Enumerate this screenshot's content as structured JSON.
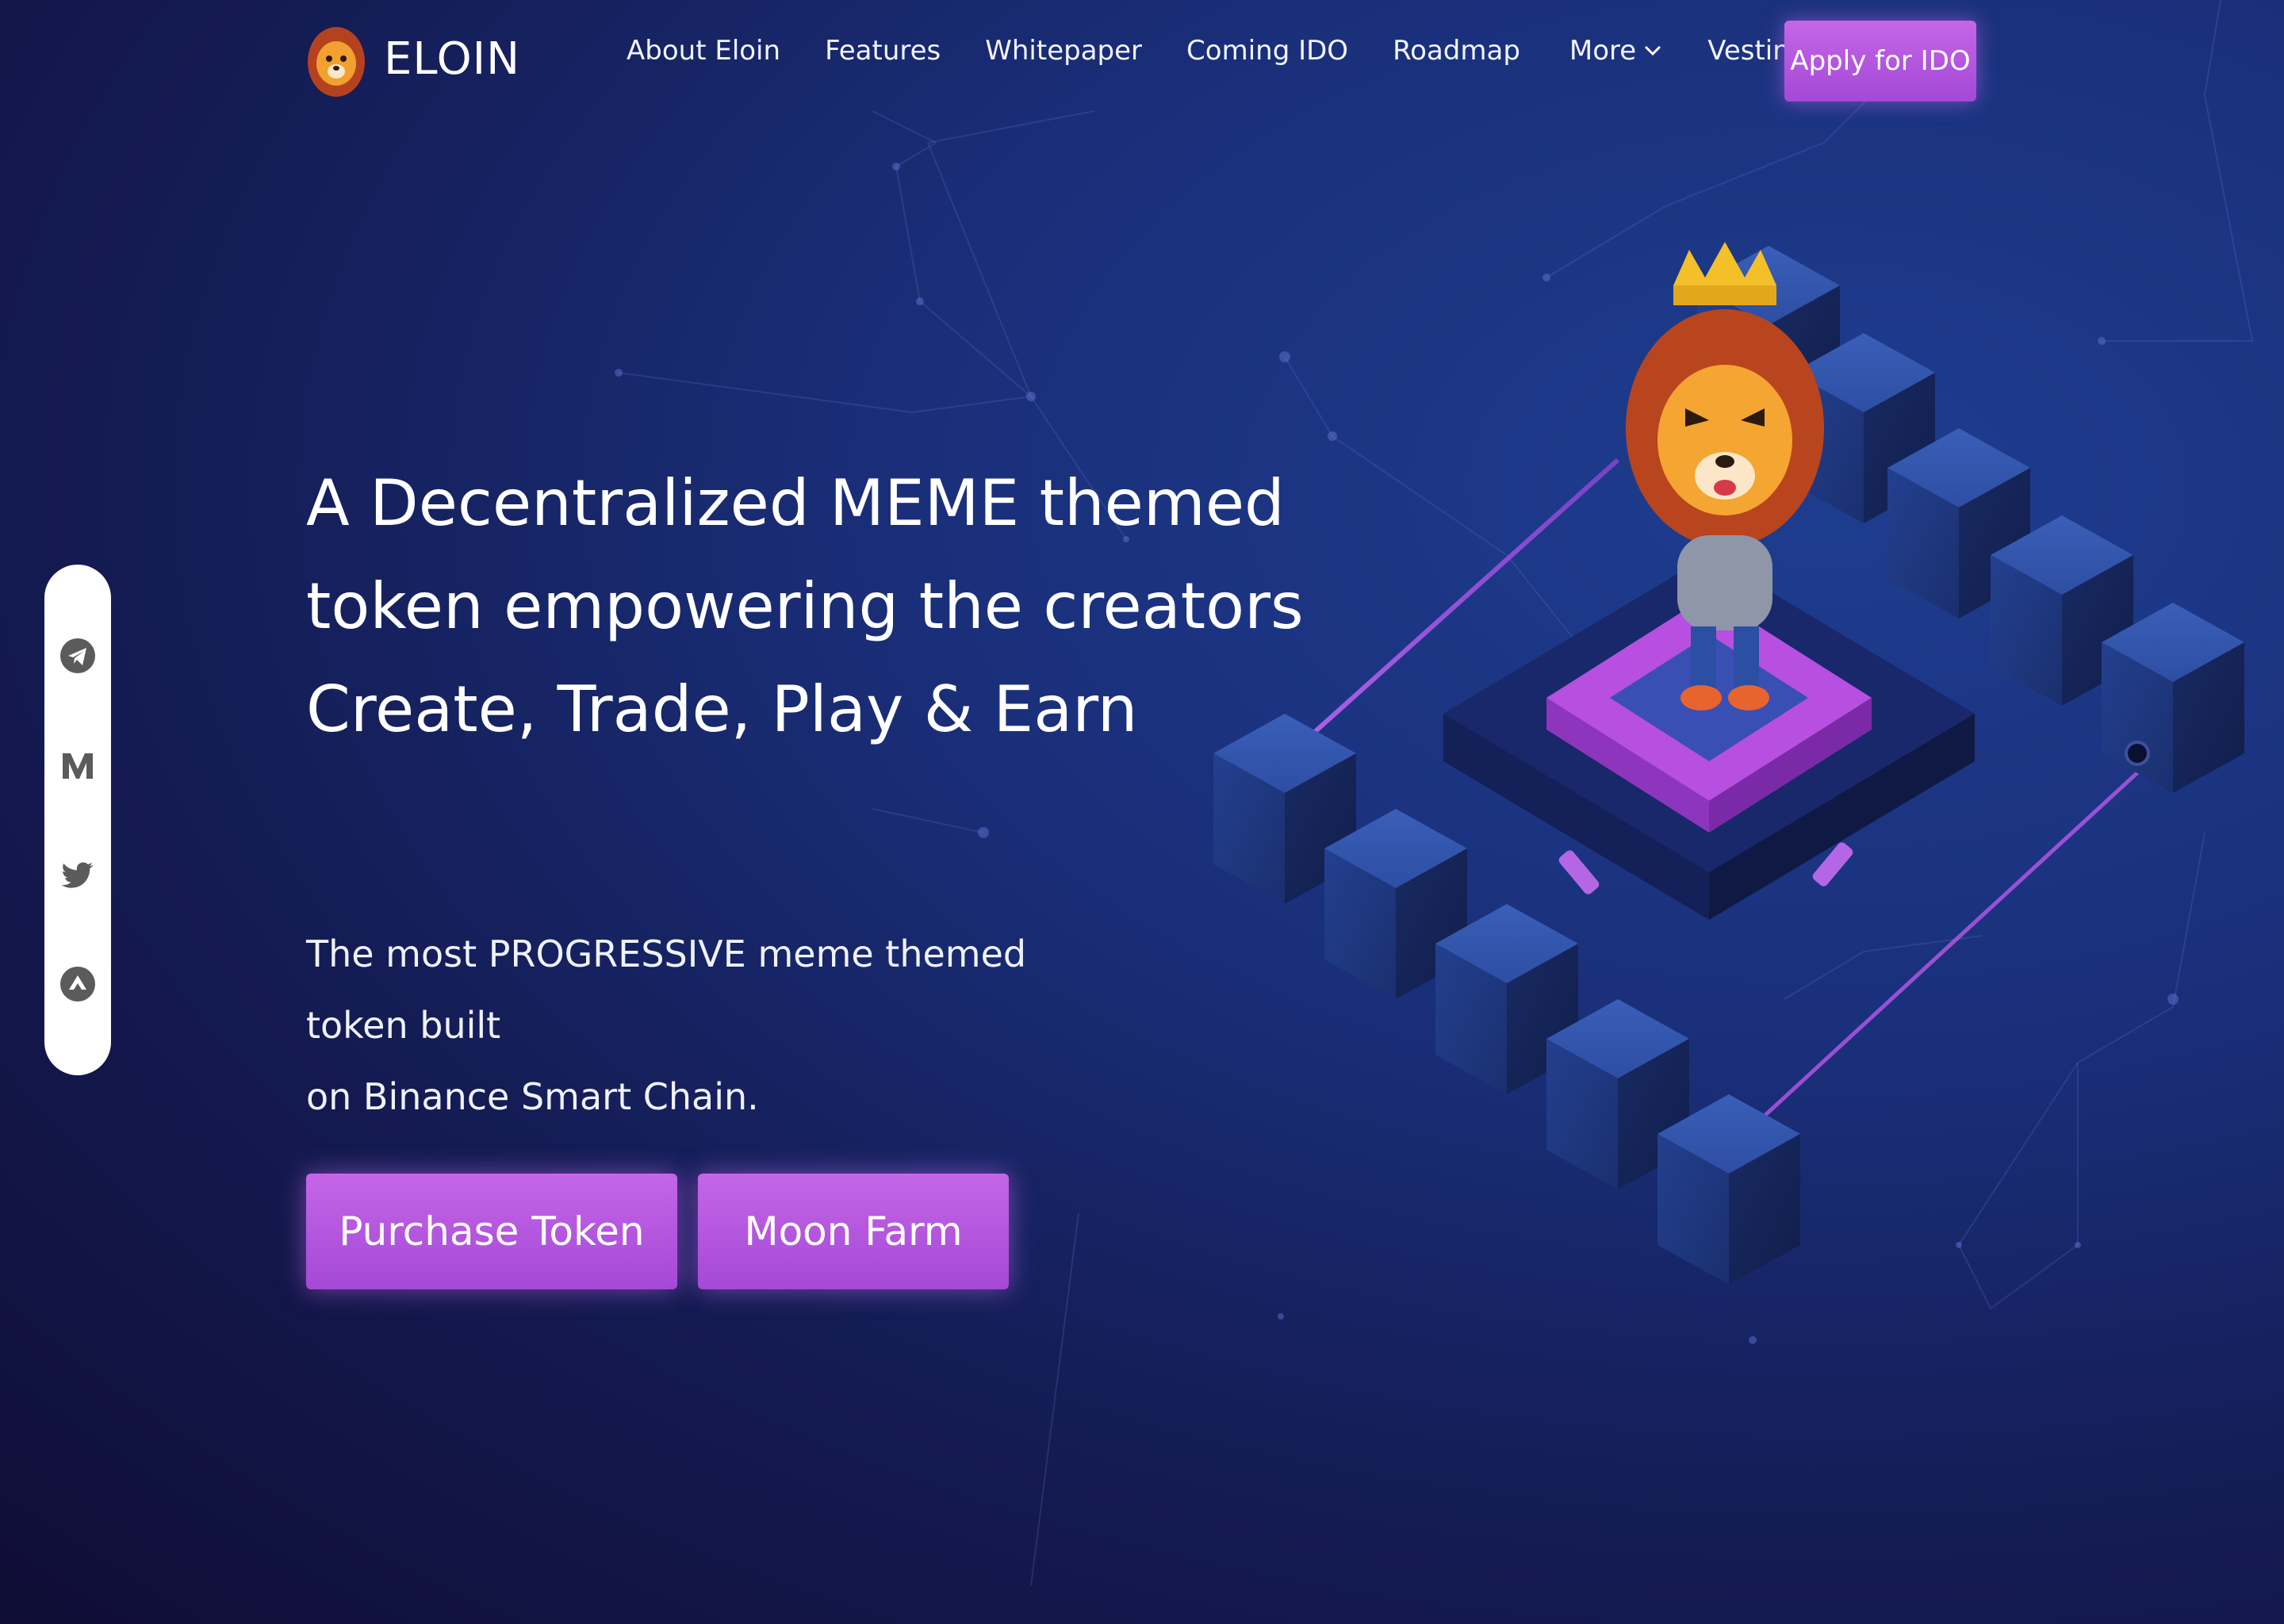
{
  "brand": {
    "name": "ELOIN",
    "logo_icon": "lion-logo-icon"
  },
  "nav": {
    "items": [
      {
        "label": "About Eloin"
      },
      {
        "label": "Features"
      },
      {
        "label": "Whitepaper"
      },
      {
        "label": "Coming IDO"
      },
      {
        "label": "Roadmap"
      },
      {
        "label": "More",
        "dropdown": true
      },
      {
        "label": "Vesting tokens",
        "dropdown": true
      }
    ],
    "cta_label": "Apply for IDO"
  },
  "social": [
    "telegram-icon",
    "medium-icon",
    "twitter-icon",
    "coinmarketcap-icon"
  ],
  "hero": {
    "title_lines": [
      "A Decentralized MEME themed",
      "token empowering the creators",
      "Create, Trade, Play & Earn"
    ],
    "subtitle_lines": [
      "The most PROGRESSIVE meme themed token built",
      "on Binance Smart Chain."
    ],
    "buttons": {
      "purchase": "Purchase Token",
      "moon_farm": "Moon Farm"
    }
  },
  "colors": {
    "accent": "#b85be3",
    "background_dark": "#0f0d35",
    "background_light": "#1e3d8f"
  }
}
